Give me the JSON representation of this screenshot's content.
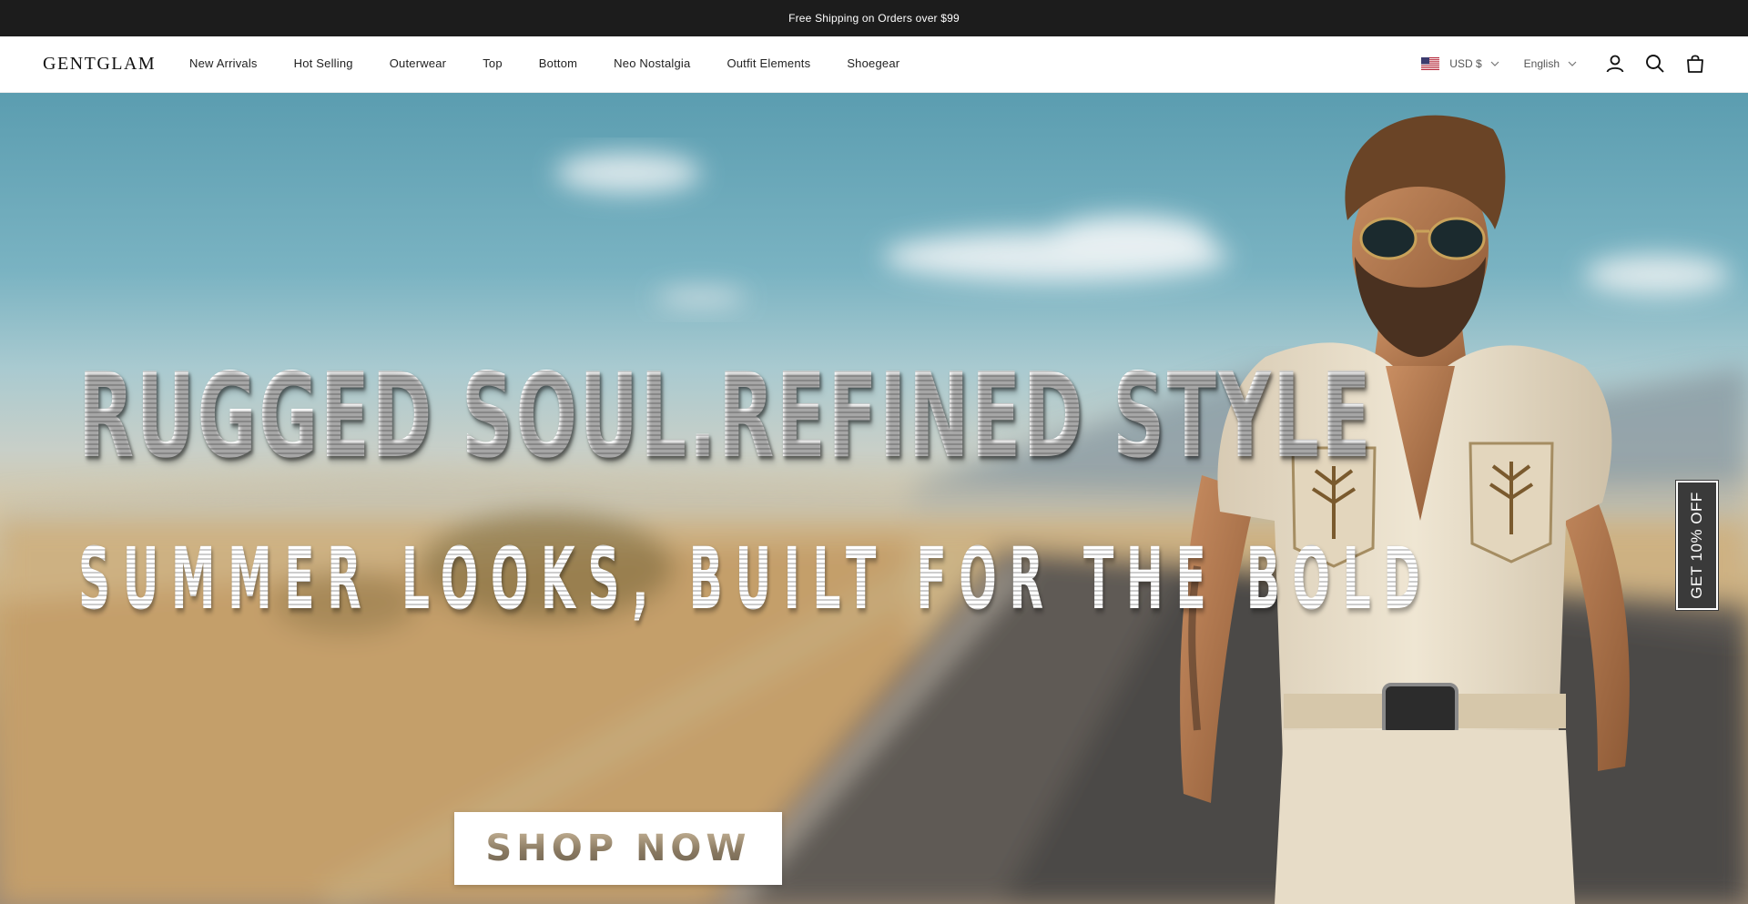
{
  "announcement": {
    "text": "Free Shipping on Orders over $99"
  },
  "header": {
    "logo": "GENTGLAM",
    "nav": [
      {
        "label": "New Arrivals"
      },
      {
        "label": "Hot Selling"
      },
      {
        "label": "Outerwear"
      },
      {
        "label": "Top"
      },
      {
        "label": "Bottom"
      },
      {
        "label": "Neo Nostalgia"
      },
      {
        "label": "Outfit Elements"
      },
      {
        "label": "Shoegear"
      }
    ],
    "currency": "USD $",
    "language": "English",
    "icons": [
      "account-icon",
      "search-icon",
      "cart-icon"
    ]
  },
  "hero": {
    "headline": "RUGGED SOUL.REFINED STYLE",
    "subheadline": "SUMMER LOOKS, BUILT FOR THE BOLD",
    "cta": "SHOP NOW"
  },
  "discount_tab": {
    "label": "GET 10% OFF"
  }
}
